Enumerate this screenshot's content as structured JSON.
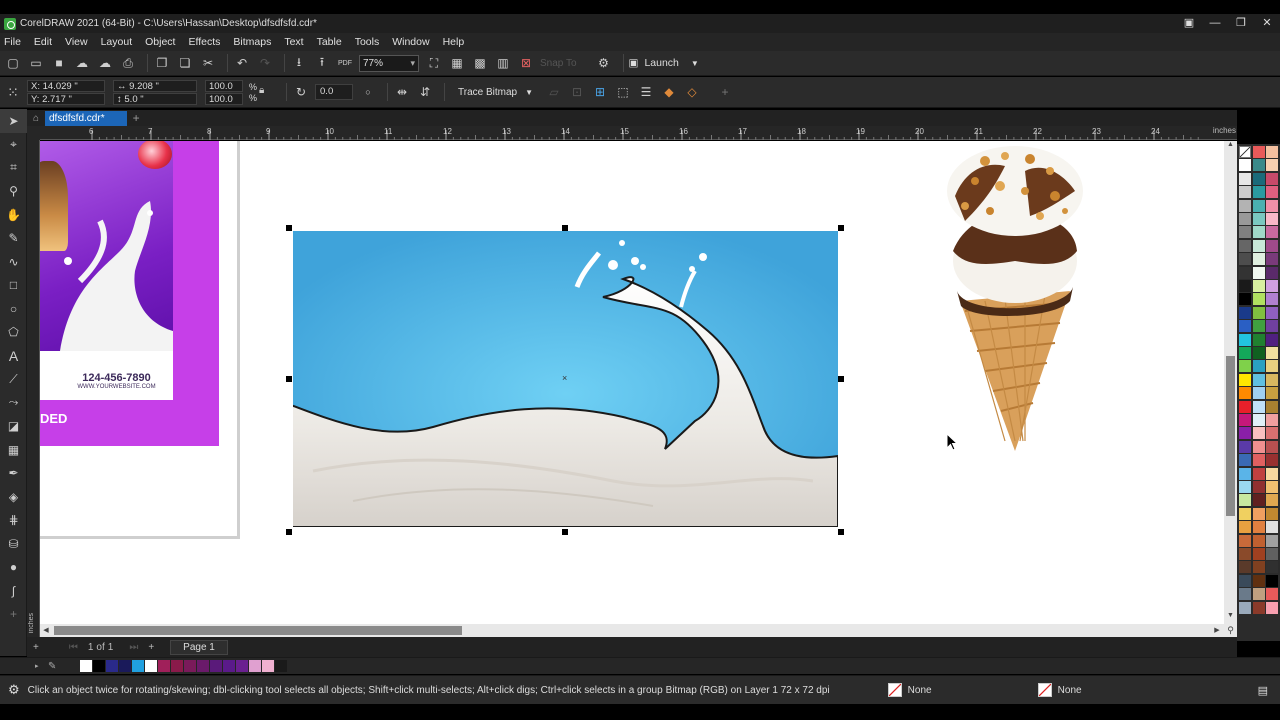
{
  "window": {
    "title": "CorelDRAW 2021 (64-Bit) - C:\\Users\\Hassan\\Desktop\\dfsdfsfd.cdr*",
    "controls": [
      "▣",
      "—",
      "❐",
      "✕"
    ]
  },
  "menu": [
    "File",
    "Edit",
    "View",
    "Layout",
    "Object",
    "Effects",
    "Bitmaps",
    "Text",
    "Table",
    "Tools",
    "Window",
    "Help"
  ],
  "toolbar": {
    "zoom": "77%",
    "snap_to": "Snap To",
    "launch": "Launch"
  },
  "property_bar": {
    "x": "14.029 \"",
    "y": "2.717 \"",
    "width": "9.208 \"",
    "height": "5.0 \"",
    "scale_x": "100.0",
    "scale_y": "100.0",
    "pct": "%",
    "rotation": "0.0",
    "trace_bitmap": "Trace Bitmap"
  },
  "document_tab": "dfsdfsfd.cdr*",
  "ruler": {
    "h_labels": [
      "6",
      "7",
      "8",
      "9",
      "10",
      "11",
      "12",
      "13",
      "14",
      "15",
      "16",
      "17",
      "18",
      "19",
      "20",
      "21",
      "22",
      "23",
      "24"
    ],
    "units": "inches"
  },
  "canvas": {
    "flyer_phone": "124-456-7890",
    "flyer_website": "WWW.YOURWEBSITE.COM",
    "flyer_partial_text": "DED"
  },
  "pages": {
    "current": "1",
    "of": "of",
    "total": "1",
    "page_tab": "Page 1"
  },
  "status": {
    "hint": "Click an object twice for rotating/skewing; dbl-clicking tool selects all objects; Shift+click multi-selects; Alt+click digs; Ctrl+click selects in a group",
    "object_info": "Bitmap (RGB) on Layer 1 72 x 72 dpi",
    "fill": "None",
    "outline": "None"
  },
  "colors": {
    "accent": "#1c66b8",
    "chrome": "#2b2b2b",
    "sky": "#5ab7e6",
    "purple": "#8a2bd6"
  }
}
